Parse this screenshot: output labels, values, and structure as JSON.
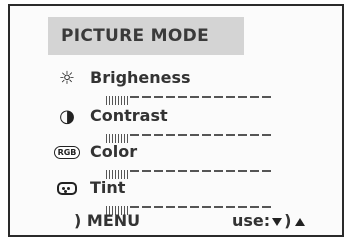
{
  "menu": {
    "title": "PICTURE MODE",
    "items": [
      {
        "label": "Brigheness",
        "icon": "sun-icon",
        "level": 0.22
      },
      {
        "label": "Contrast",
        "icon": "half-circle-icon",
        "level": 0.22
      },
      {
        "label": "Color",
        "icon": "rgb-icon",
        "icon_text": "RGB",
        "level": 0.22
      },
      {
        "label": "Tint",
        "icon": "tint-icon",
        "level": 0.22
      }
    ],
    "footer": {
      "menu_prefix": ")",
      "menu_label": "MENU",
      "use_label": "use:",
      "paren": ")"
    }
  },
  "colors": {
    "title_bg": "#d4d4d4",
    "border": "#2a2a2a",
    "text": "#333333"
  }
}
